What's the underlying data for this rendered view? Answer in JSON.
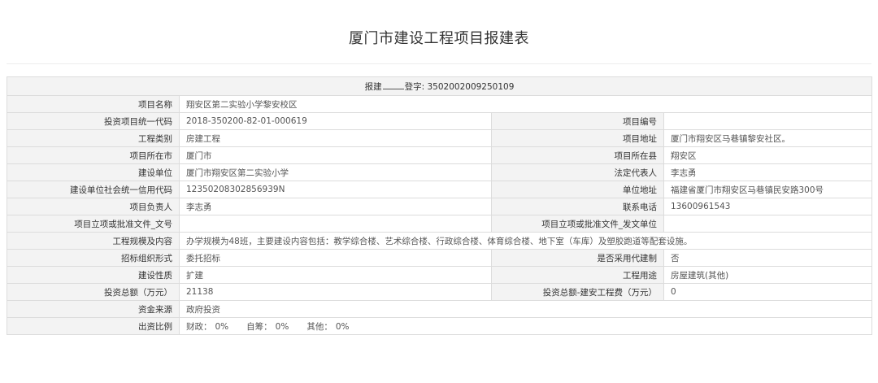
{
  "page": {
    "title": "厦门市建设工程项目报建表"
  },
  "header_row": {
    "prefix": "报建",
    "middle": "登字: 3502002009250109"
  },
  "fields": {
    "project_name": {
      "label": "项目名称",
      "value": "翔安区第二实验小学黎安校区"
    },
    "investment_code": {
      "label": "投资项目统一代码",
      "value": "2018-350200-82-01-000619"
    },
    "project_number": {
      "label": "项目编号",
      "value": ""
    },
    "project_category": {
      "label": "工程类别",
      "value": "房建工程"
    },
    "project_address": {
      "label": "项目地址",
      "value": "厦门市翔安区马巷镇黎安社区。"
    },
    "project_city": {
      "label": "项目所在市",
      "value": "厦门市"
    },
    "project_county": {
      "label": "项目所在县",
      "value": "翔安区"
    },
    "construction_unit": {
      "label": "建设单位",
      "value": "厦门市翔安区第二实验小学"
    },
    "legal_rep": {
      "label": "法定代表人",
      "value": "李志勇"
    },
    "credit_code": {
      "label": "建设单位社会统一信用代码",
      "value": "12350208302856939N"
    },
    "unit_address": {
      "label": "单位地址",
      "value": "福建省厦门市翔安区马巷镇民安路300号"
    },
    "project_manager": {
      "label": "项目负责人",
      "value": "李志勇"
    },
    "contact_phone": {
      "label": "联系电话",
      "value": "13600961543"
    },
    "approval_doc_no": {
      "label": "项目立项或批准文件_文号",
      "value": ""
    },
    "approval_unit": {
      "label": "项目立项或批准文件_发文单位",
      "value": ""
    },
    "scale_content": {
      "label": "工程规模及内容",
      "value": "办学规模为48班，主要建设内容包括：教学综合楼、艺术综合楼、行政综合楼、体育综合楼、地下室（车库）及塑胶跑道等配套设施。"
    },
    "bidding_form": {
      "label": "招标组织形式",
      "value": "委托招标"
    },
    "agent_system": {
      "label": "是否采用代建制",
      "value": "否"
    },
    "construction_nature": {
      "label": "建设性质",
      "value": "扩建"
    },
    "project_use": {
      "label": "工程用途",
      "value": "房屋建筑(其他)"
    },
    "total_investment": {
      "label": "投资总额（万元）",
      "value": "21138"
    },
    "investment_construction_cost": {
      "label": "投资总额-建安工程费（万元）",
      "value": "0"
    },
    "fund_source": {
      "label": "资金来源",
      "value": "政府投资"
    },
    "funding_ratio": {
      "label": "出资比例",
      "fiscal_label": "财政：",
      "fiscal_value": "0%",
      "self_label": "自筹：",
      "self_value": "0%",
      "other_label": "其他：",
      "other_value": "0%"
    }
  },
  "colors": {
    "label_bg": "#f3f3f3",
    "border": "#dcdcdc",
    "text": "#333333"
  }
}
